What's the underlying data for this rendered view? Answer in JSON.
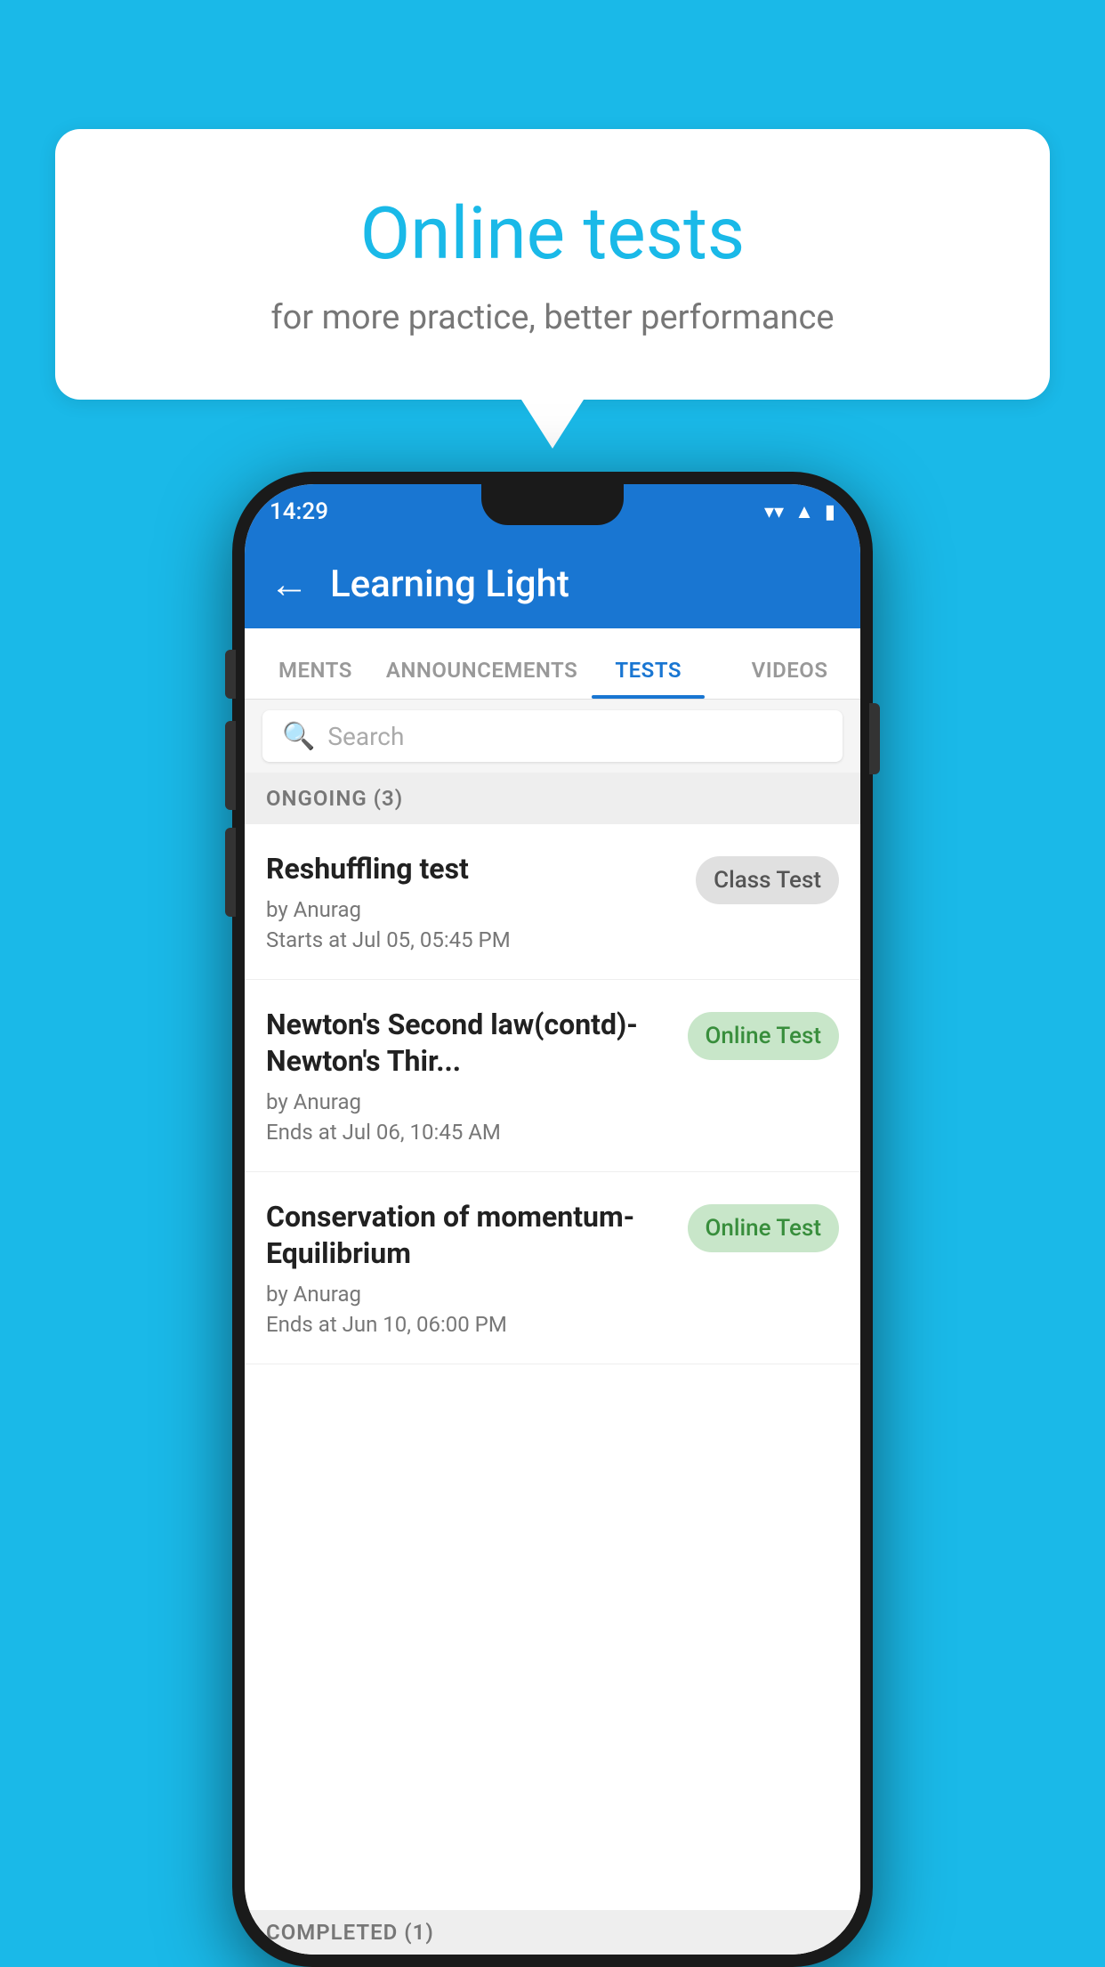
{
  "background_color": "#1ab9e8",
  "speech_bubble": {
    "title": "Online tests",
    "subtitle": "for more practice, better performance"
  },
  "status_bar": {
    "time": "14:29",
    "wifi": "▾",
    "signal": "▲",
    "battery": "▮"
  },
  "app_bar": {
    "title": "Learning Light",
    "back_label": "←"
  },
  "tabs": [
    {
      "label": "MENTS",
      "active": false
    },
    {
      "label": "ANNOUNCEMENTS",
      "active": false
    },
    {
      "label": "TESTS",
      "active": true
    },
    {
      "label": "VIDEOS",
      "active": false
    }
  ],
  "search": {
    "placeholder": "Search"
  },
  "ongoing_section": {
    "label": "ONGOING (3)"
  },
  "tests": [
    {
      "name": "Reshuffling test",
      "author": "by Anurag",
      "date": "Starts at  Jul 05, 05:45 PM",
      "badge": "Class Test",
      "badge_type": "class"
    },
    {
      "name": "Newton's Second law(contd)-Newton's Thir...",
      "author": "by Anurag",
      "date": "Ends at  Jul 06, 10:45 AM",
      "badge": "Online Test",
      "badge_type": "online"
    },
    {
      "name": "Conservation of momentum-Equilibrium",
      "author": "by Anurag",
      "date": "Ends at  Jun 10, 06:00 PM",
      "badge": "Online Test",
      "badge_type": "online"
    }
  ],
  "completed_section": {
    "label": "COMPLETED (1)"
  }
}
